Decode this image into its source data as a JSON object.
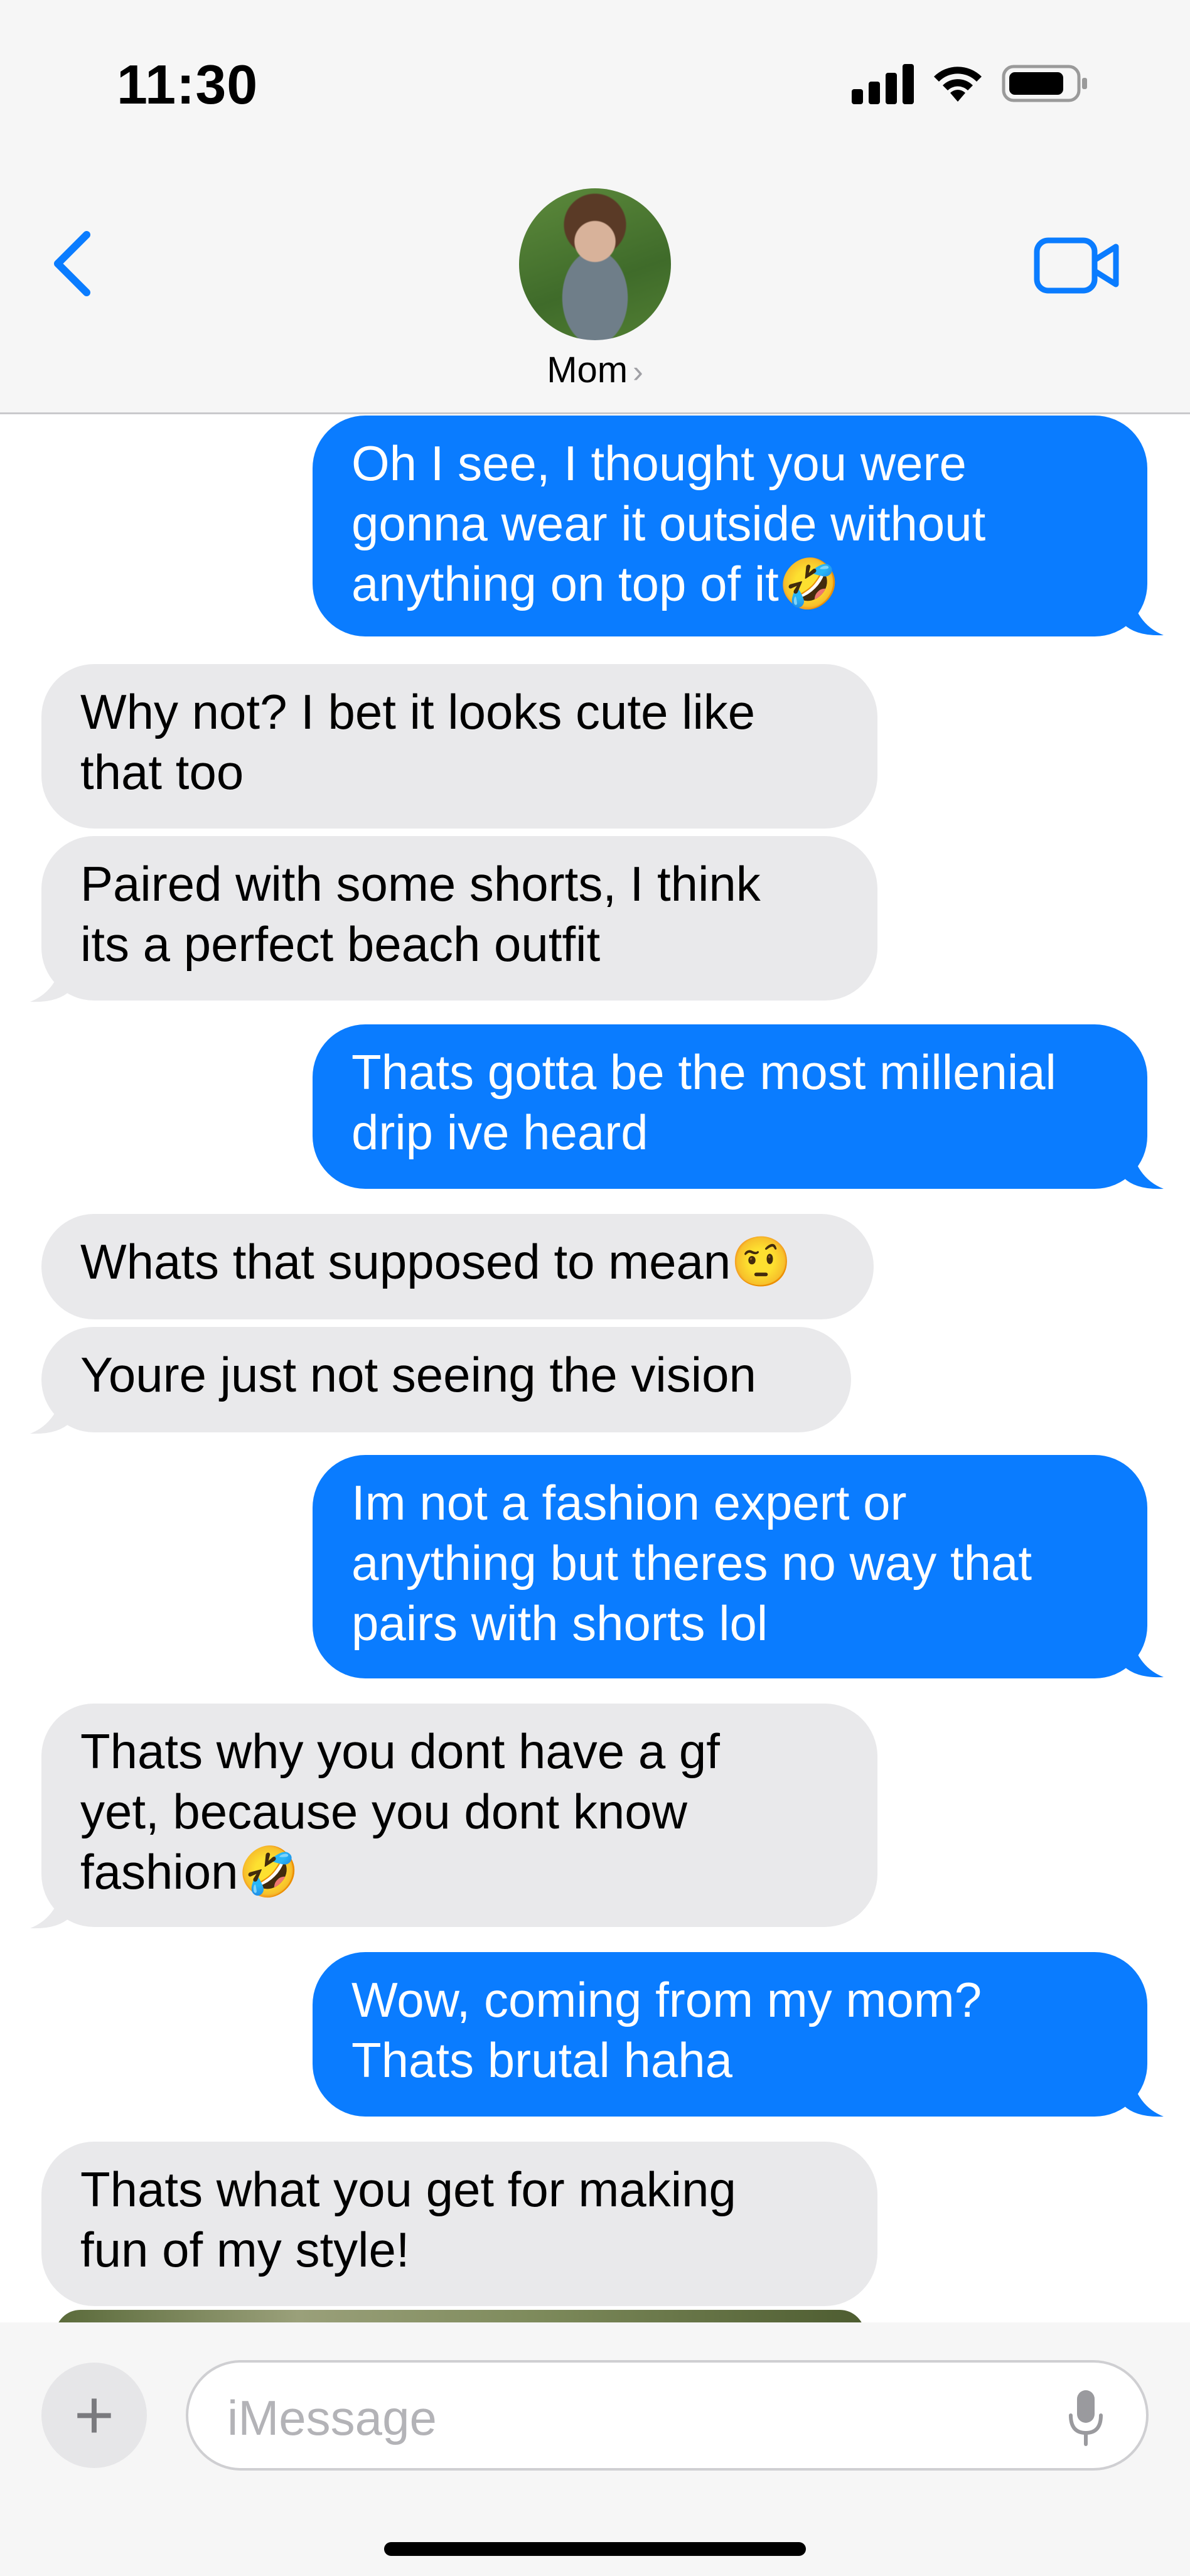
{
  "status_bar": {
    "time": "11:30"
  },
  "header": {
    "contact_name": "Mom",
    "name_chevron": "›"
  },
  "messages": [
    {
      "sender": "me",
      "text": "Oh I see, I thought you were\ngonna wear it outside without\nanything on top of it🤣"
    },
    {
      "sender": "them",
      "text": "Why not? I bet it looks cute like\nthat too"
    },
    {
      "sender": "them",
      "text": "Paired with some shorts, I think\nits a perfect beach outfit"
    },
    {
      "sender": "me",
      "text": "Thats gotta be the most millenial\ndrip ive heard"
    },
    {
      "sender": "them",
      "text": "Whats that supposed to mean🤨"
    },
    {
      "sender": "them",
      "text": "Youre just not seeing the vision"
    },
    {
      "sender": "me",
      "text": "Im not a fashion expert or\nanything but theres no way that\npairs with shorts lol"
    },
    {
      "sender": "them",
      "text": "Thats why you dont have a gf\nyet, because you dont know\nfashion🤣"
    },
    {
      "sender": "me",
      "text": "Wow, coming from my mom?\nThats brutal haha"
    },
    {
      "sender": "them",
      "text": "Thats what you get for making\nfun of my style!"
    }
  ],
  "compose": {
    "placeholder": "iMessage",
    "plus_label": "+"
  },
  "colors": {
    "outgoing": "#0a7cff",
    "incoming": "#e9e9eb",
    "accent": "#0a7cff"
  },
  "icons": [
    "back-chevron-icon",
    "video-camera-icon",
    "signal-icon",
    "wifi-icon",
    "battery-icon",
    "microphone-icon",
    "plus-icon"
  ]
}
